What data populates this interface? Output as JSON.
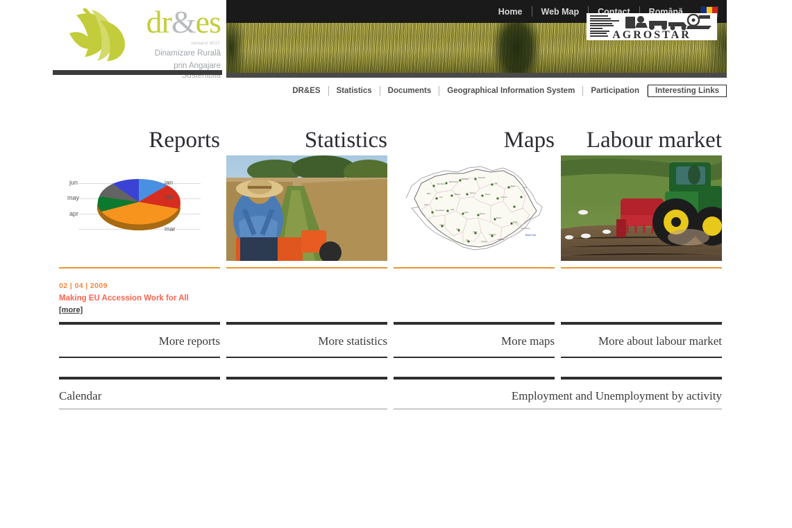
{
  "header": {
    "logo": {
      "word_dr": "dr",
      "word_amp": "&",
      "word_es": "es",
      "issue": "numarul 4517",
      "tagline_line1": "Dinamizare Rurală",
      "tagline_line2": "prin Angajare Sustenibilă",
      "mark_icon": "leaf-sprout-logo-icon"
    },
    "top_nav": [
      {
        "label": "Home",
        "name": "home"
      },
      {
        "label": "Web Map",
        "name": "web-map"
      },
      {
        "label": "Contact",
        "name": "contact"
      },
      {
        "label": "Română",
        "name": "language-romana"
      }
    ],
    "flag": {
      "name": "romanian-flag-icon",
      "colors": [
        "#0b2d8e",
        "#f5c51e",
        "#d4221a"
      ]
    },
    "banner": {
      "name": "wheat-field-banner",
      "alt": "wheat field with dark green path"
    },
    "agrostar": {
      "wordmark": "AGROSTAR",
      "org_lines": [
        "Federatia",
        "Nationala a",
        "Sindicatelor din",
        "Agricultura,",
        "Alimentatie,",
        "Tutun,",
        "Domenii si",
        "Servicii",
        "Conexe"
      ],
      "art_icon": "tractor-harvester-illustration-icon"
    }
  },
  "main_nav": {
    "items": [
      {
        "label": "DR&ES",
        "name": "dres",
        "active": false
      },
      {
        "label": "Statistics",
        "name": "statistics",
        "active": false
      },
      {
        "label": "Documents",
        "name": "documents",
        "active": false
      },
      {
        "label": "Geographical Information System",
        "name": "gis",
        "active": false
      },
      {
        "label": "Participation",
        "name": "participation",
        "active": false
      },
      {
        "label": "Interesting Links",
        "name": "interesting-links",
        "active": true
      }
    ]
  },
  "sections": {
    "headings": [
      "Reports",
      "Statistics",
      "Maps",
      "Labour market"
    ],
    "thumbs": [
      {
        "name": "reports-pie-chart",
        "kind": "chart"
      },
      {
        "name": "statistics-farmer-tractor-photo",
        "kind": "photo",
        "alt": "farmer on orange tractor between corn rows"
      },
      {
        "name": "maps-romania-counties",
        "kind": "map",
        "alt": "outline map of Romania with counties"
      },
      {
        "name": "labour-market-tractor-seeder-photo",
        "kind": "photo",
        "alt": "green tractor with red seed drill on ploughed field"
      }
    ],
    "more_links": [
      "More reports",
      "More statistics",
      "More maps",
      "More about labour market"
    ]
  },
  "news": {
    "date": "02 | 04 | 2009",
    "title": "Making EU Accession Work for All",
    "more_label": "[more]"
  },
  "bottom": {
    "left_label": "Calendar",
    "right_label": "Employment and Unemployment by activity"
  },
  "colors": {
    "brand_green": "#c3cd3c",
    "brand_gray": "#b9bcbe",
    "accent_orange": "#e8962e",
    "news_date": "#f0883c",
    "news_title": "#fa6450",
    "dark_bar": "#2e2e2e",
    "header_dark": "#1a1a1a"
  },
  "chart_data": {
    "type": "pie",
    "title": "",
    "categories": [
      "jan",
      "feb",
      "mar",
      "apr",
      "may",
      "jun"
    ],
    "values": [
      12,
      18,
      27,
      18,
      11,
      14
    ],
    "colors": [
      "#4a90e2",
      "#d62d20",
      "#f7941e",
      "#0c7a2e",
      "#636363",
      "#3b43d4"
    ],
    "label_positions": [
      "right",
      "right",
      "right",
      "left",
      "left",
      "left"
    ],
    "legend": "inline-leader-labels",
    "three_d": true
  }
}
